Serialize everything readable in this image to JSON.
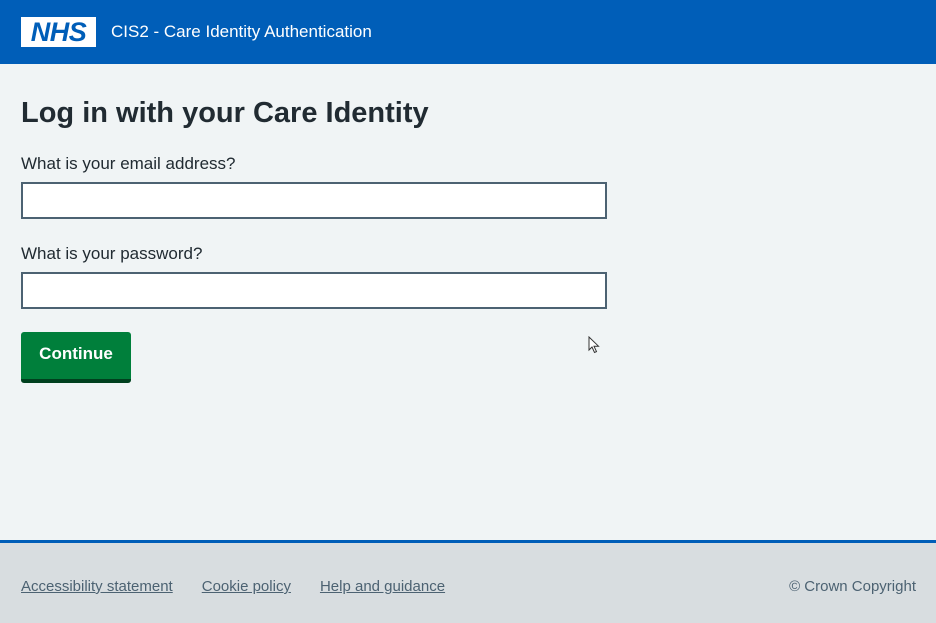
{
  "header": {
    "logo_text": "NHS",
    "service_name": "CIS2 - Care Identity Authentication"
  },
  "main": {
    "title": "Log in with your Care Identity",
    "email": {
      "label": "What is your email address?",
      "value": "",
      "placeholder": ""
    },
    "password": {
      "label": "What is your password?",
      "value": "",
      "placeholder": ""
    },
    "continue_label": "Continue"
  },
  "footer": {
    "links": [
      "Accessibility statement",
      "Cookie policy",
      "Help and guidance"
    ],
    "copyright": "© Crown Copyright"
  },
  "colors": {
    "header_blue": "#005eb8",
    "button_green": "#007f3b",
    "background": "#f0f4f5",
    "footer_bg": "#d8dde0"
  }
}
